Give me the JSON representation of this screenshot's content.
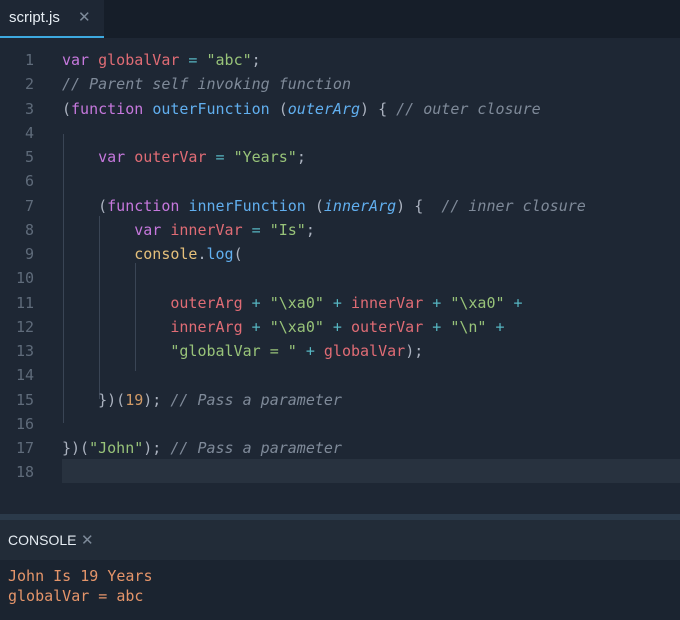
{
  "tab": {
    "label": "script.js",
    "close": "✕"
  },
  "editor": {
    "lines": [
      {
        "n": "1",
        "tokens": [
          [
            "kw",
            "var "
          ],
          [
            "vr",
            "globalVar"
          ],
          [
            "op",
            " = "
          ],
          [
            "st",
            "\"abc\""
          ],
          [
            "pu",
            ";"
          ]
        ]
      },
      {
        "n": "2",
        "tokens": [
          [
            "cm",
            "// Parent self invoking function"
          ]
        ]
      },
      {
        "n": "3",
        "tokens": [
          [
            "pu",
            "("
          ],
          [
            "kw",
            "function "
          ],
          [
            "fn",
            "outerFunction "
          ],
          [
            "pu",
            "("
          ],
          [
            "pr",
            "outerArg"
          ],
          [
            "pu",
            ") { "
          ],
          [
            "cm",
            "// outer closure"
          ]
        ]
      },
      {
        "n": "4",
        "tokens": []
      },
      {
        "n": "5",
        "tokens": [
          [
            "pu",
            "    "
          ],
          [
            "kw",
            "var "
          ],
          [
            "vr",
            "outerVar"
          ],
          [
            "op",
            " = "
          ],
          [
            "st",
            "\"Years\""
          ],
          [
            "pu",
            ";"
          ]
        ]
      },
      {
        "n": "6",
        "tokens": []
      },
      {
        "n": "7",
        "tokens": [
          [
            "pu",
            "    ("
          ],
          [
            "kw",
            "function "
          ],
          [
            "fn",
            "innerFunction "
          ],
          [
            "pu",
            "("
          ],
          [
            "pr",
            "innerArg"
          ],
          [
            "pu",
            ") {  "
          ],
          [
            "cm",
            "// inner closure"
          ]
        ]
      },
      {
        "n": "8",
        "tokens": [
          [
            "pu",
            "        "
          ],
          [
            "kw",
            "var "
          ],
          [
            "vr",
            "innerVar"
          ],
          [
            "op",
            " = "
          ],
          [
            "st",
            "\"Is\""
          ],
          [
            "pu",
            ";"
          ]
        ]
      },
      {
        "n": "9",
        "tokens": [
          [
            "pu",
            "        "
          ],
          [
            "ob",
            "console"
          ],
          [
            "pu",
            "."
          ],
          [
            "fn",
            "log"
          ],
          [
            "pu",
            "("
          ]
        ]
      },
      {
        "n": "10",
        "tokens": []
      },
      {
        "n": "11",
        "tokens": [
          [
            "pu",
            "            "
          ],
          [
            "vr",
            "outerArg"
          ],
          [
            "op",
            " + "
          ],
          [
            "st",
            "\"\\xa0\""
          ],
          [
            "op",
            " + "
          ],
          [
            "vr",
            "innerVar"
          ],
          [
            "op",
            " + "
          ],
          [
            "st",
            "\"\\xa0\""
          ],
          [
            "op",
            " +"
          ]
        ]
      },
      {
        "n": "12",
        "tokens": [
          [
            "pu",
            "            "
          ],
          [
            "vr",
            "innerArg"
          ],
          [
            "op",
            " + "
          ],
          [
            "st",
            "\"\\xa0\""
          ],
          [
            "op",
            " + "
          ],
          [
            "vr",
            "outerVar"
          ],
          [
            "op",
            " + "
          ],
          [
            "st",
            "\"\\n\""
          ],
          [
            "op",
            " +"
          ]
        ]
      },
      {
        "n": "13",
        "tokens": [
          [
            "pu",
            "            "
          ],
          [
            "st",
            "\"globalVar = \""
          ],
          [
            "op",
            " + "
          ],
          [
            "vr",
            "globalVar"
          ],
          [
            "pu",
            ");"
          ]
        ]
      },
      {
        "n": "14",
        "tokens": []
      },
      {
        "n": "15",
        "tokens": [
          [
            "pu",
            "    })("
          ],
          [
            "nm",
            "19"
          ],
          [
            "pu",
            "); "
          ],
          [
            "cm",
            "// Pass a parameter"
          ]
        ]
      },
      {
        "n": "16",
        "tokens": []
      },
      {
        "n": "17",
        "tokens": [
          [
            "pu",
            "})("
          ],
          [
            "st",
            "\"John\""
          ],
          [
            "pu",
            "); "
          ],
          [
            "cm",
            "// Pass a parameter"
          ]
        ]
      },
      {
        "n": "18",
        "tokens": []
      }
    ]
  },
  "console": {
    "title": "CONSOLE",
    "close": "✕",
    "output": [
      "John Is 19 Years",
      "globalVar = abc"
    ]
  },
  "colors": {
    "keyword": "#c678dd",
    "variable": "#e06c75",
    "string": "#98c379",
    "comment": "#7f8a99",
    "function": "#61afef",
    "console_output": "#e5956a",
    "tab_accent": "#3da9e0"
  }
}
